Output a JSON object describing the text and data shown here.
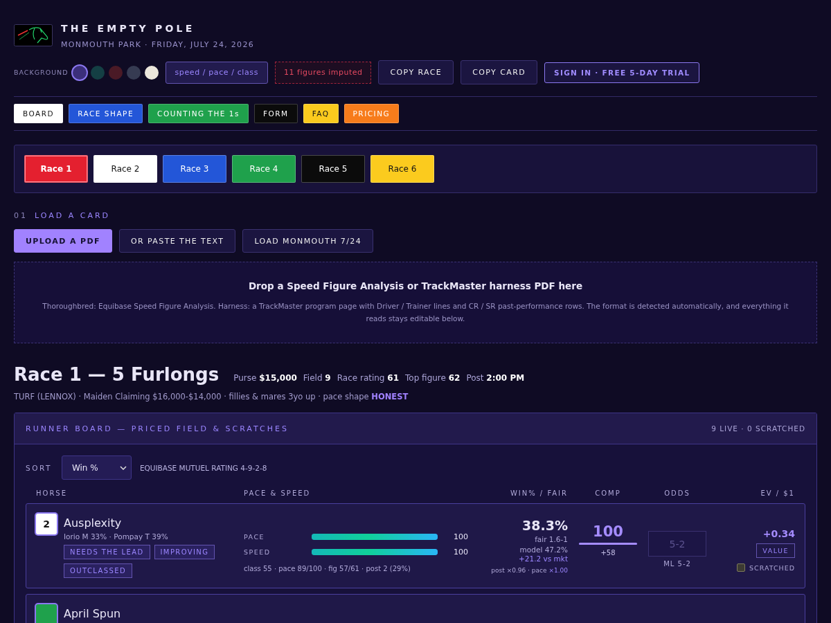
{
  "brand": {
    "title": "THE EMPTY POLE",
    "subtitle": "MONMOUTH PARK · FRIDAY, JULY 24, 2026"
  },
  "toolbar": {
    "background_label": "BACKGROUND",
    "swatches": [
      {
        "color": "#3b2f7a",
        "selected": true
      },
      {
        "color": "#143f44",
        "selected": false
      },
      {
        "color": "#4a1a26",
        "selected": false
      },
      {
        "color": "#363b52",
        "selected": false
      },
      {
        "color": "#ece7dc",
        "selected": false
      }
    ],
    "mode": "speed / pace / class",
    "imputed": "11 figures imputed",
    "buttons": [
      "COPY RACE",
      "COPY CARD"
    ],
    "signin": "SIGN IN · FREE 5-DAY TRIAL"
  },
  "nav": [
    {
      "label": "BOARD",
      "color": "#ffffff"
    },
    {
      "label": "RACE SHAPE",
      "color": "#2356d8"
    },
    {
      "label": "COUNTING THE 1s",
      "color": "#1fa14c"
    },
    {
      "label": "FORM",
      "color": "#0b0b0b"
    },
    {
      "label": "FAQ",
      "color": "#fbcb1e"
    },
    {
      "label": "PRICING",
      "color": "#f77c1b"
    }
  ],
  "races": [
    {
      "label": "Race 1",
      "color": "#e4202f",
      "selected": true
    },
    {
      "label": "Race 2",
      "color": "#ffffff",
      "selected": false
    },
    {
      "label": "Race 3",
      "color": "#2356d8",
      "selected": false
    },
    {
      "label": "Race 4",
      "color": "#1fa14c",
      "selected": false
    },
    {
      "label": "Race 5",
      "color": "#0b0b0b",
      "selected": false
    },
    {
      "label": "Race 6",
      "color": "#fbcb1e",
      "selected": false
    }
  ],
  "load": {
    "step": "01",
    "title": "LOAD A CARD",
    "buttons": [
      {
        "label": "UPLOAD A PDF",
        "primary": true
      },
      {
        "label": "OR PASTE THE TEXT",
        "primary": false
      },
      {
        "label": "LOAD MONMOUTH 7/24",
        "primary": false
      }
    ],
    "drop_title": "Drop a Speed Figure Analysis or TrackMaster harness PDF here",
    "drop_text": "Thoroughbred: Equibase Speed Figure Analysis. Harness: a TrackMaster program page with Driver / Trainer lines and CR / SR past-performance rows. The format is detected automatically, and everything it reads stays editable below."
  },
  "race": {
    "title": "Race 1 — 5 Furlongs",
    "stats": [
      {
        "label": "Purse",
        "value": "$15,000"
      },
      {
        "label": "Field",
        "value": "9"
      },
      {
        "label": "Race rating",
        "value": "61"
      },
      {
        "label": "Top figure",
        "value": "62"
      },
      {
        "label": "Post",
        "value": "2:00 PM"
      }
    ],
    "conditions": "TURF (LENNOX) · Maiden Claiming $16,000-$14,000 · fillies & mares 3yo up · pace shape",
    "pace_shape": "HONEST"
  },
  "board": {
    "title": "RUNNER BOARD — PRICED FIELD & SCRATCHES",
    "count": "9 LIVE · 0 SCRATCHED",
    "sort_label": "SORT",
    "sort_value": "Win %",
    "rating": "EQUIBASE MUTUEL RATING 4-9-2-8",
    "columns": [
      "HORSE",
      "PACE & SPEED",
      "WIN% / FAIR",
      "COMP",
      "ODDS",
      "EV / $1"
    ],
    "runners": [
      {
        "number": "2",
        "color": "#ffffff",
        "name": "Ausplexity",
        "connections": "Iorio M 33% · Pompay T 39%",
        "tags": [
          "NEEDS THE LEAD",
          "IMPROVING",
          "OUTCLASSED"
        ],
        "bars": [
          {
            "label": "PACE",
            "level": 1,
            "reading": "100"
          },
          {
            "label": "SPEED",
            "level": 1,
            "reading": "100"
          }
        ],
        "detail": "class 55 · pace 89/100 · fig 57/61 · post 2 (29%)",
        "win": "38.3%",
        "fair": "fair 1.6-1",
        "model": "model 47.2%",
        "edge": "+21.2 vs mkt",
        "factors": "post ×0.96 · pace",
        "pace_factor": "×1.00",
        "comp": "100",
        "comp_meter": {
          "level": 1
        },
        "comp_delta": "+58",
        "odds_placeholder": "5-2",
        "ml": "ML 5-2",
        "ev": "+0.34",
        "ev_tag": "VALUE",
        "scratch_label": "SCRATCHED",
        "scratched": false
      },
      {
        "color": "#1fa14c",
        "name": "April Spun"
      }
    ]
  }
}
